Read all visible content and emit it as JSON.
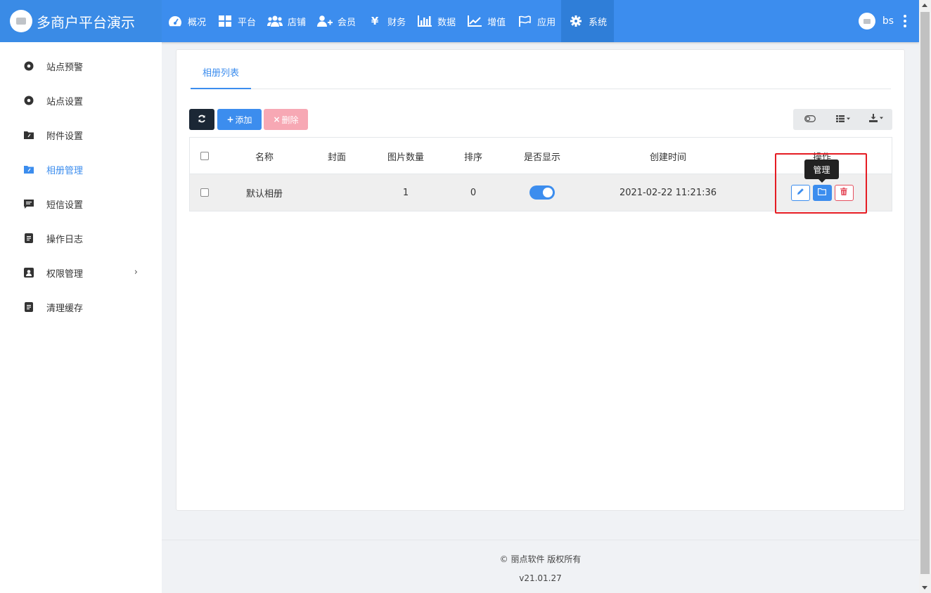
{
  "brand": {
    "title": "多商户平台演示"
  },
  "nav": {
    "items": [
      {
        "label": "概况",
        "icon": "dashboard-icon"
      },
      {
        "label": "平台",
        "icon": "grid-icon"
      },
      {
        "label": "店铺",
        "icon": "users-icon"
      },
      {
        "label": "会员",
        "icon": "user-plus-icon"
      },
      {
        "label": "财务",
        "icon": "yen-icon"
      },
      {
        "label": "数据",
        "icon": "bar-chart-icon"
      },
      {
        "label": "增值",
        "icon": "line-chart-icon"
      },
      {
        "label": "应用",
        "icon": "flag-icon"
      },
      {
        "label": "系统",
        "icon": "gear-icon",
        "active": true
      }
    ],
    "user": "bs"
  },
  "sidebar": {
    "items": [
      {
        "label": "站点预警",
        "icon": "circle-dot-icon"
      },
      {
        "label": "站点设置",
        "icon": "circle-dot-icon"
      },
      {
        "label": "附件设置",
        "icon": "folder-clip-icon"
      },
      {
        "label": "相册管理",
        "icon": "folder-clip-icon",
        "active": true
      },
      {
        "label": "短信设置",
        "icon": "message-icon"
      },
      {
        "label": "操作日志",
        "icon": "document-icon"
      },
      {
        "label": "权限管理",
        "icon": "user-badge-icon",
        "has_children": true
      },
      {
        "label": "清理缓存",
        "icon": "document-icon"
      }
    ]
  },
  "tabs": [
    {
      "label": "相册列表"
    }
  ],
  "toolbar": {
    "refresh_icon": "refresh-icon",
    "add_label": "添加",
    "delete_label": "删除"
  },
  "table": {
    "headers": [
      "名称",
      "封面",
      "图片数量",
      "排序",
      "是否显示",
      "创建时间",
      "操作"
    ],
    "rows": [
      {
        "name": "默认相册",
        "cover": "",
        "count": "1",
        "sort": "0",
        "visible": true,
        "created": "2021-02-22 11:21:36"
      }
    ]
  },
  "tooltip": {
    "text": "管理"
  },
  "footer": {
    "copyright": "© 丽点软件 版权所有",
    "version": "v21.01.27"
  },
  "colors": {
    "primary": "#3c8dee",
    "danger": "#e5505f",
    "dark": "#1b2735",
    "highlight": "#e51c23"
  }
}
